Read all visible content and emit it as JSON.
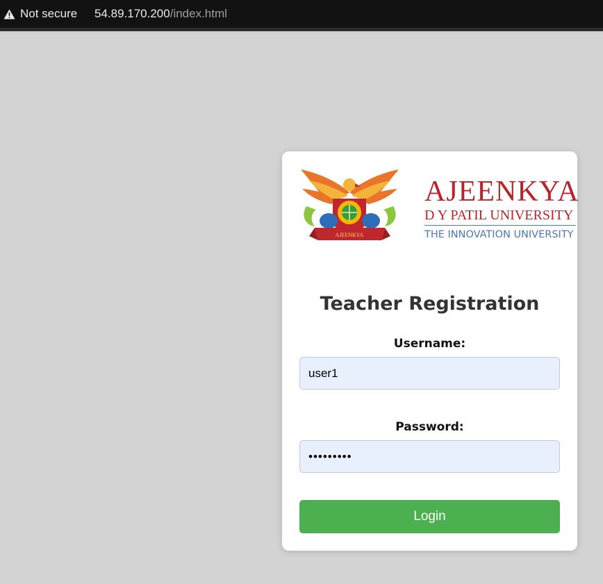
{
  "browser": {
    "security_label": "Not secure",
    "url_host": "54.89.170.200",
    "url_path": "/index.html",
    "warning_icon": "warning-triangle-icon"
  },
  "logo": {
    "name": "AJEENKYA",
    "subtitle": "D Y PATIL UNIVERSITY",
    "tagline": "THE INNOVATION UNIVERSITY",
    "emblem_banner": "AJEENKYA",
    "brand_red": "#b8242a",
    "brand_blue": "#4a78b8"
  },
  "form": {
    "title": "Teacher Registration",
    "username_label": "Username:",
    "username_value": "user1",
    "password_label": "Password:",
    "password_value": "•••••••••",
    "login_label": "Login",
    "button_color": "#4caf50",
    "input_bg": "#e8f0fe"
  }
}
